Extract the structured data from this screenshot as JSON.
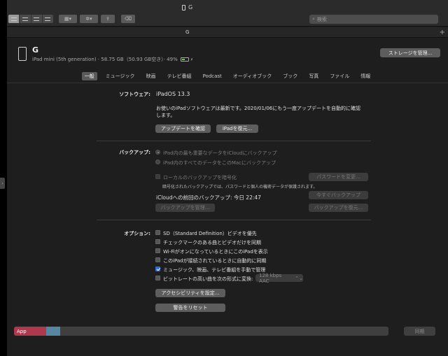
{
  "window": {
    "title": "G"
  },
  "toolbar": {
    "search_placeholder": "検索",
    "gear_glyph": "✲",
    "gear_caret": "▾",
    "share_glyph": "⇪",
    "back_glyph": "⌫",
    "grid_caret": "▾"
  },
  "tab": {
    "title": "G",
    "plus": "+"
  },
  "device": {
    "name": "G",
    "info": "iPad mini (5th generation) · 58.75 GB（50.93 GB空き）· 49%",
    "battery_level": 0.49,
    "manage_storage_label": "ストレージを管理..."
  },
  "content_tabs": [
    {
      "label": "一般",
      "selected": true
    },
    {
      "label": "ミュージック"
    },
    {
      "label": "映画"
    },
    {
      "label": "テレビ番組"
    },
    {
      "label": "Podcast"
    },
    {
      "label": "オーディオブック"
    },
    {
      "label": "ブック"
    },
    {
      "label": "写真"
    },
    {
      "label": "ファイル"
    },
    {
      "label": "情報"
    }
  ],
  "software": {
    "label": "ソフトウェア:",
    "version": "iPadOS 13.3",
    "message_line1": "お使いのiPadソフトウェアは最新です。2020/01/06にもう一度アップデートを自動的に確認",
    "message_line2": "します。",
    "check_update_label": "アップデートを確認",
    "restore_label": "iPadを復元..."
  },
  "backup": {
    "label": "バックアップ:",
    "option_icloud": "iPad内の最も重要なデータをiCloudにバックアップ",
    "option_mac": "iPad内のすべてのデータをこのMacにバックアップ",
    "encrypt_label": "ローカルのバックアップを暗号化",
    "encrypt_note": "暗号化されたバックアップでは、パスワードと個人の機密データが保護されます。",
    "change_password_label": "パスワードを変更...",
    "last_backup": "iCloudへの前回のバックアップ: 今日 22:47",
    "backup_now_label": "今すぐバックアップ",
    "manage_backups_label": "バックアップを管理...",
    "restore_backup_label": "バックアップを復元..."
  },
  "options": {
    "label": "オプション:",
    "items": [
      {
        "label": "SD（Standard Definition）ビデオを優先",
        "checked": false
      },
      {
        "label": "チェックマークのある曲とビデオだけを同期",
        "checked": false
      },
      {
        "label": "Wi-FiがオンになっているときにこのiPadを表示",
        "checked": false
      },
      {
        "label": "このiPadが接続されているときに自動的に同期",
        "checked": false
      },
      {
        "label": "ミュージック、映画、テレビ番組を手動で管理",
        "checked": true
      },
      {
        "label": "ビットレートの高い曲を次の形式に変換:",
        "checked": false
      }
    ],
    "bitrate_value": "128 kbps AAC",
    "bitrate_caret": "⌃⌄",
    "accessibility_label": "アクセシビリティを設定...",
    "reset_warnings_label": "警告をリセット"
  },
  "storage_bar": {
    "app_label": "App"
  },
  "sync_label": "同期",
  "colors": {
    "app_segment": "#b0384d",
    "other_segment": "#5687a2",
    "checkbox_on": "#2f6fd6",
    "battery": "#5fcf4a"
  }
}
